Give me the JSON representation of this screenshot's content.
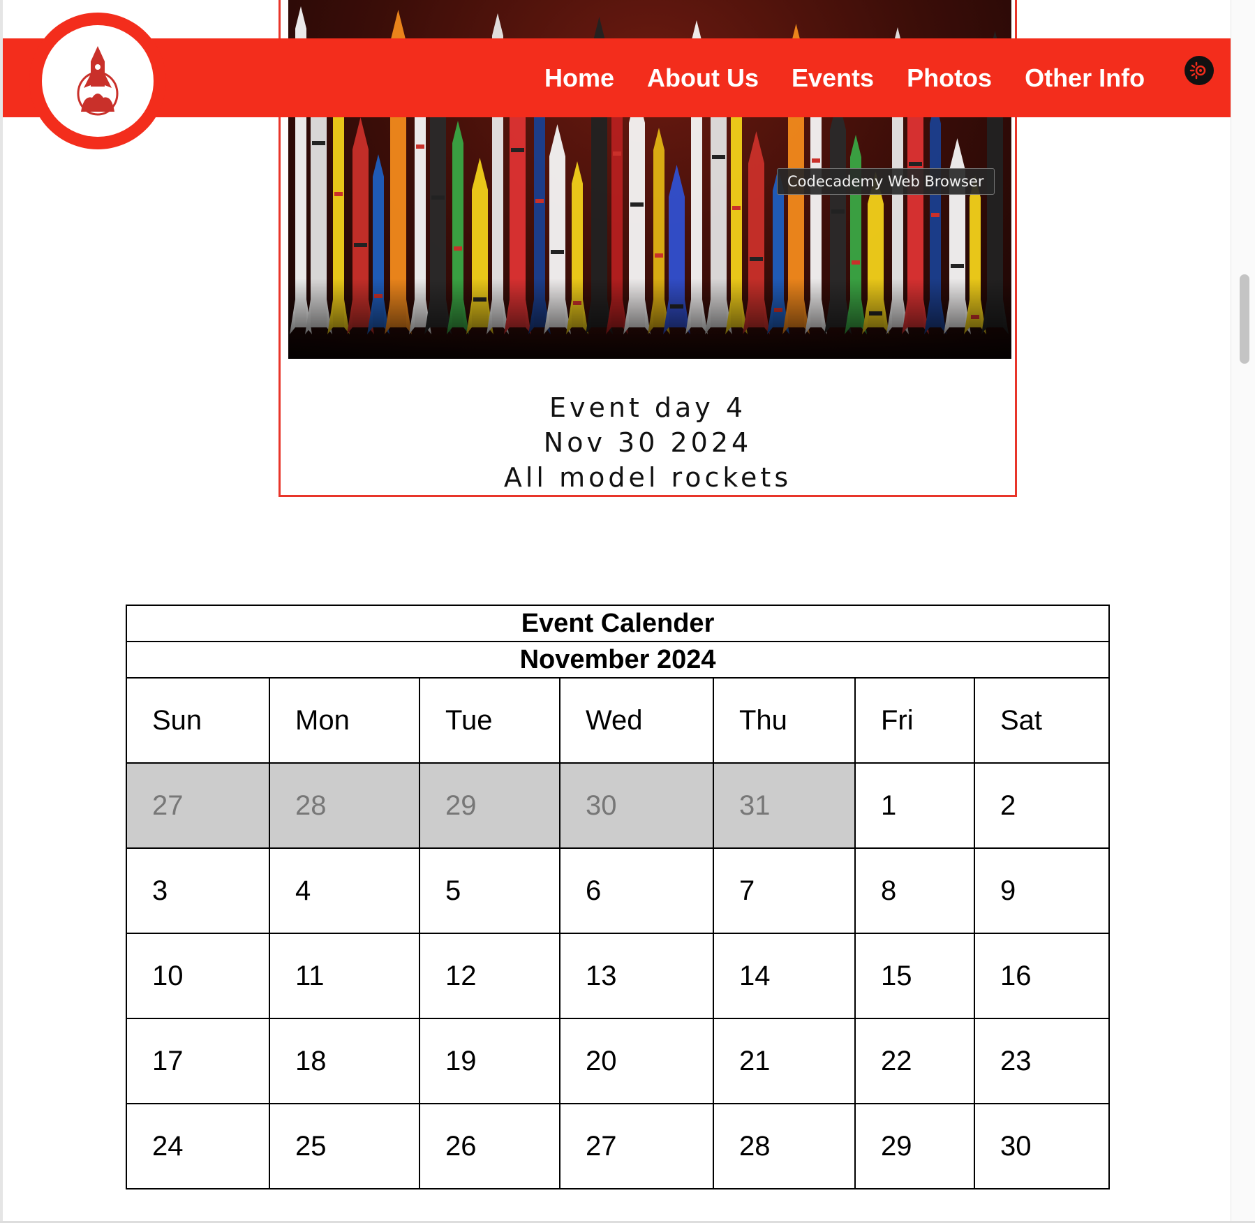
{
  "nav": {
    "items": [
      "Home",
      "About Us",
      "Events",
      "Photos",
      "Other Info"
    ],
    "icon": "settings-eye-icon",
    "brand_color": "#f32d1c"
  },
  "event": {
    "line1": "Event day 4",
    "line2": "Nov 30 2024",
    "line3": "All model rockets"
  },
  "tooltip": "Codecademy Web Browser",
  "calendar": {
    "title": "Event Calender",
    "month": "November 2024",
    "days": [
      "Sun",
      "Mon",
      "Tue",
      "Wed",
      "Thu",
      "Fri",
      "Sat"
    ],
    "weeks": [
      [
        "27",
        "28",
        "29",
        "30",
        "31",
        "1",
        "2"
      ],
      [
        "3",
        "4",
        "5",
        "6",
        "7",
        "8",
        "9"
      ],
      [
        "10",
        "11",
        "12",
        "13",
        "14",
        "15",
        "16"
      ],
      [
        "17",
        "18",
        "19",
        "20",
        "21",
        "22",
        "23"
      ],
      [
        "24",
        "25",
        "26",
        "27",
        "28",
        "29",
        "30"
      ]
    ],
    "previous_month_cells": 5
  }
}
